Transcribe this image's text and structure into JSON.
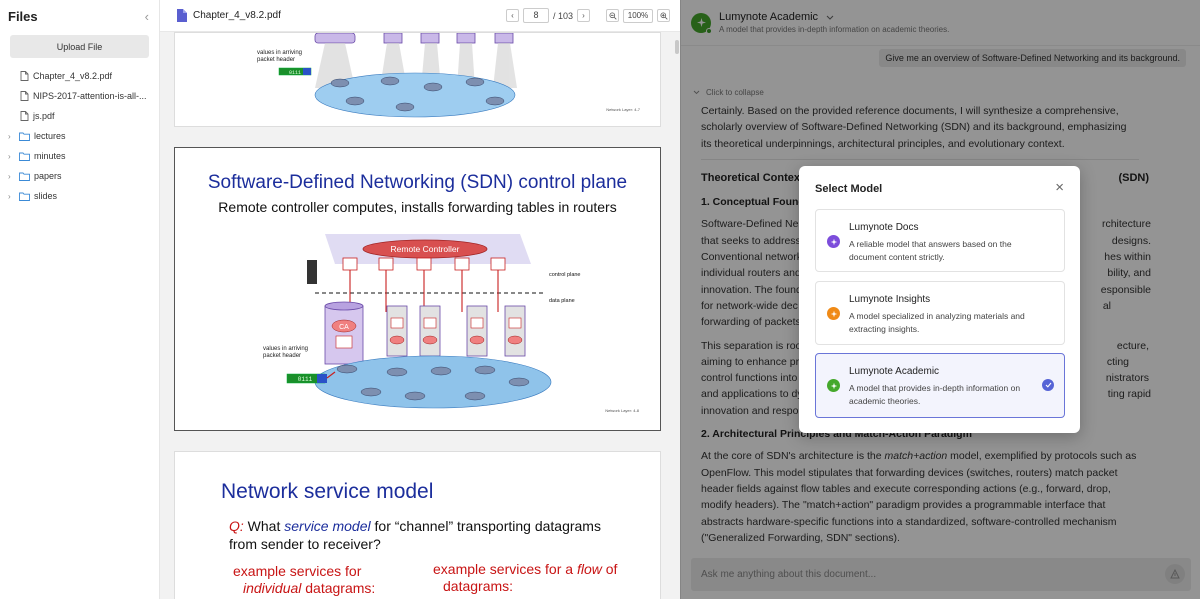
{
  "sidebar": {
    "title": "Files",
    "upload_label": "Upload File",
    "files": [
      {
        "label": "Chapter_4_v8.2.pdf"
      },
      {
        "label": "NIPS-2017-attention-is-all-..."
      },
      {
        "label": "js.pdf"
      }
    ],
    "folders": [
      {
        "label": "lectures"
      },
      {
        "label": "minutes"
      },
      {
        "label": "papers"
      },
      {
        "label": "slides"
      }
    ]
  },
  "viewer": {
    "doc_name": "Chapter_4_v8.2.pdf",
    "page": "8",
    "page_total": "/ 103",
    "zoom": "100%",
    "pages": {
      "p1": {
        "label_arriving": "values in arriving",
        "label_header": "packet header",
        "header_bits": "0111",
        "footer": "Network Layer: 4-7"
      },
      "p2": {
        "title": "Software-Defined Networking (SDN) control plane",
        "subtitle": "Remote controller computes, installs forwarding tables in routers",
        "remote_controller": "Remote Controller",
        "ca": "CA",
        "control_plane": "control plane",
        "data_plane": "data plane",
        "label_arriving": "values in arriving",
        "label_header": "packet header",
        "header_bits": "0111",
        "footer": "Network Layer: 4-8"
      },
      "p3": {
        "title": "Network service model",
        "q_prefix": "Q:",
        "q_text_1": "What",
        "q_service_model": "service model",
        "q_text_2": "for “channel” transporting datagrams",
        "q_text_3": "from sender to receiver?",
        "left_1": "example services for",
        "left_2_italic": "individual",
        "left_2_rest": "datagrams:",
        "right_1": "example services for a",
        "right_1_italic": "flow",
        "right_1_rest": "of",
        "right_2": "datagrams:"
      }
    }
  },
  "chat": {
    "name": "Lumynote Academic",
    "desc": "A model that provides in-depth information on academic theories.",
    "user_message": "Give me an overview of Software-Defined Networking and its background.",
    "collapse": "Click to collapse",
    "intro": "Certainly. Based on the provided reference documents, I will synthesize a comprehensive, scholarly overview of Software-Defined Networking (SDN) and its background, emphasizing its theoretical underpinnings, architectural principles, and evolutionary context.",
    "h_theory_left": "Theoretical Contex",
    "h_theory_right": "(SDN)",
    "h_conceptual": "1. Conceptual Founda",
    "para1_lines": [
      {
        "left": "Software-Defined Ne",
        "right": "rchitecture"
      },
      {
        "left": "that seeks to address",
        "right": "designs."
      },
      {
        "left": "Conventional network",
        "right": "hes within"
      },
      {
        "left": "individual routers and",
        "right": "bility, and"
      },
      {
        "left": "innovation. The found",
        "right": "esponsible"
      },
      {
        "left": "for network-wide dec",
        "right": "al"
      },
      {
        "left": "forwarding of packets",
        "right": ""
      }
    ],
    "para2_lines": [
      {
        "left": "This separation is roo",
        "right": "ecture,"
      },
      {
        "left": "aiming to enhance pr",
        "right": "cting"
      },
      {
        "left": "control functions into",
        "right": "nistrators"
      },
      {
        "left": "and applications to dy",
        "right": "ting rapid"
      },
      {
        "left": "innovation and respo",
        "right": ""
      }
    ],
    "h_arch": "2. Architectural Principles and Match-Action Paradigm",
    "para3_pre": "At the core of SDN's architecture is the ",
    "para3_em": "match+action",
    "para3_post": " model, exemplified by protocols such as OpenFlow. This model stipulates that forwarding devices (switches, routers) match packet header fields against flow tables and execute corresponding actions (e.g., forward, drop, modify headers). The \"match+action\" paradigm provides a programmable interface that abstracts hardware-specific functions into a standardized, software-controlled mechanism (\"Generalized Forwarding, SDN\" sections).",
    "input_placeholder": "Ask me anything about this document..."
  },
  "modal": {
    "title": "Select Model",
    "options": [
      {
        "name": "Lumynote Docs",
        "desc": "A reliable model that answers based on the document content strictly.",
        "color": "#7c4ddb",
        "selected": false
      },
      {
        "name": "Lumynote Insights",
        "desc": "A model specialized in analyzing materials and extracting insights.",
        "color": "#f08a16",
        "selected": false
      },
      {
        "name": "Lumynote Academic",
        "desc": "A model that provides in-depth information on academic theories.",
        "color": "#45a82c",
        "selected": true
      }
    ]
  },
  "colors": {
    "accent": "#5664d6",
    "slide_blue": "#1c2e9c",
    "slide_red": "#c81414",
    "academic_green": "#45a82c"
  }
}
